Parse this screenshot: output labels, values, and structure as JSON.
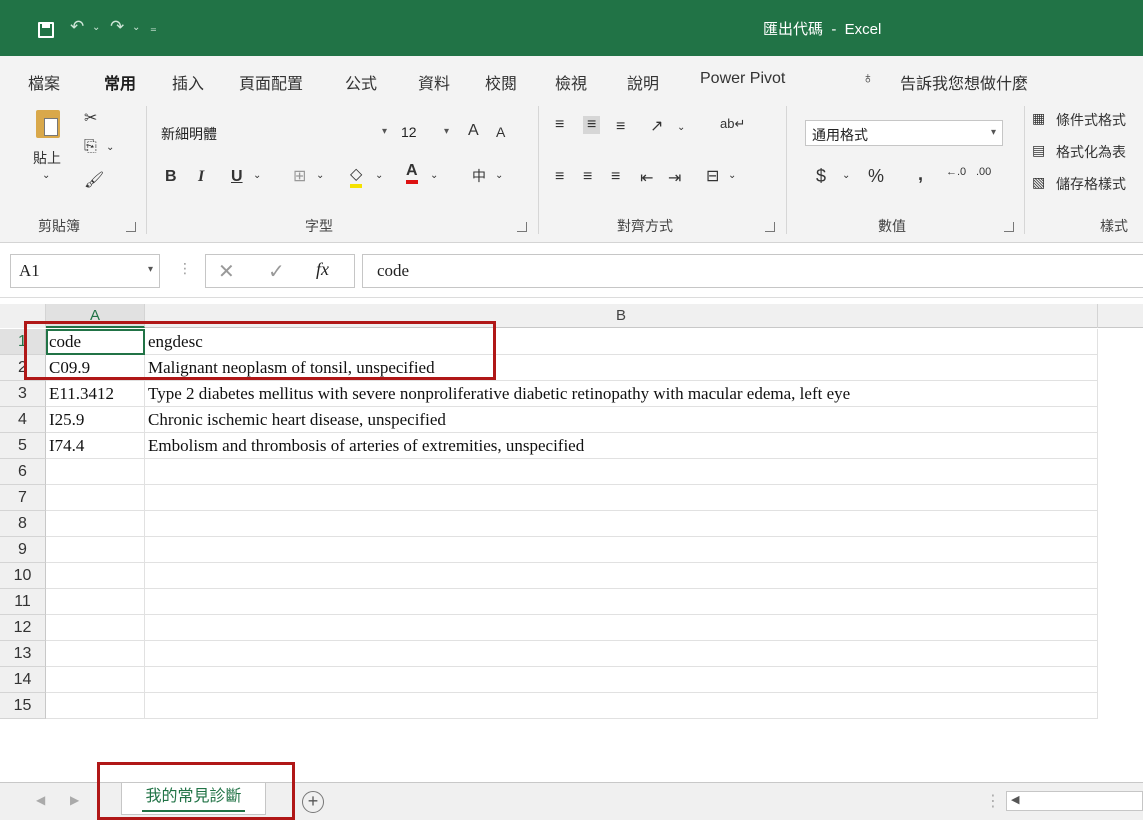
{
  "window": {
    "title": "匯出代碼  -  Excel"
  },
  "tabs": [
    "檔案",
    "常用",
    "插入",
    "頁面配置",
    "公式",
    "資料",
    "校閱",
    "檢視",
    "說明",
    "Power Pivot"
  ],
  "tell_me": "告訴我您想做什麼",
  "ribbon": {
    "clipboard": {
      "label": "剪貼簿",
      "paste_label": "貼上"
    },
    "font": {
      "label": "字型",
      "name": "新細明體",
      "size": "12",
      "bold": "B",
      "italic": "I",
      "underline": "U",
      "grow": "A",
      "shrink": "A"
    },
    "alignment": {
      "label": "對齊方式"
    },
    "number": {
      "label": "數值",
      "format": "通用格式",
      "currency": "$",
      "percent": "%",
      "comma": ","
    },
    "styles": {
      "label": "樣式",
      "conditional": "條件式格式",
      "format_as_table": "格式化為表",
      "cell_styles": "儲存格樣式"
    }
  },
  "formula_bar": {
    "name_box": "A1",
    "fx": "fx",
    "formula": "code"
  },
  "columns": [
    "A",
    "B"
  ],
  "rows": [
    "1",
    "2",
    "3",
    "4",
    "5",
    "6",
    "7",
    "8",
    "9",
    "10",
    "11",
    "12",
    "13",
    "14",
    "15"
  ],
  "cells": [
    {
      "a": "code",
      "b": "engdesc"
    },
    {
      "a": "C09.9",
      "b": "Malignant neoplasm of tonsil, unspecified"
    },
    {
      "a": "E11.3412",
      "b": "Type 2 diabetes mellitus with severe nonproliferative diabetic retinopathy with macular edema, left eye"
    },
    {
      "a": "I25.9",
      "b": "Chronic ischemic heart disease, unspecified"
    },
    {
      "a": "I74.4",
      "b": "Embolism and thrombosis of arteries of extremities, unspecified"
    }
  ],
  "sheet_tab": "我的常見診斷",
  "colors": {
    "accent": "#217346",
    "annotation": "#b01717"
  }
}
